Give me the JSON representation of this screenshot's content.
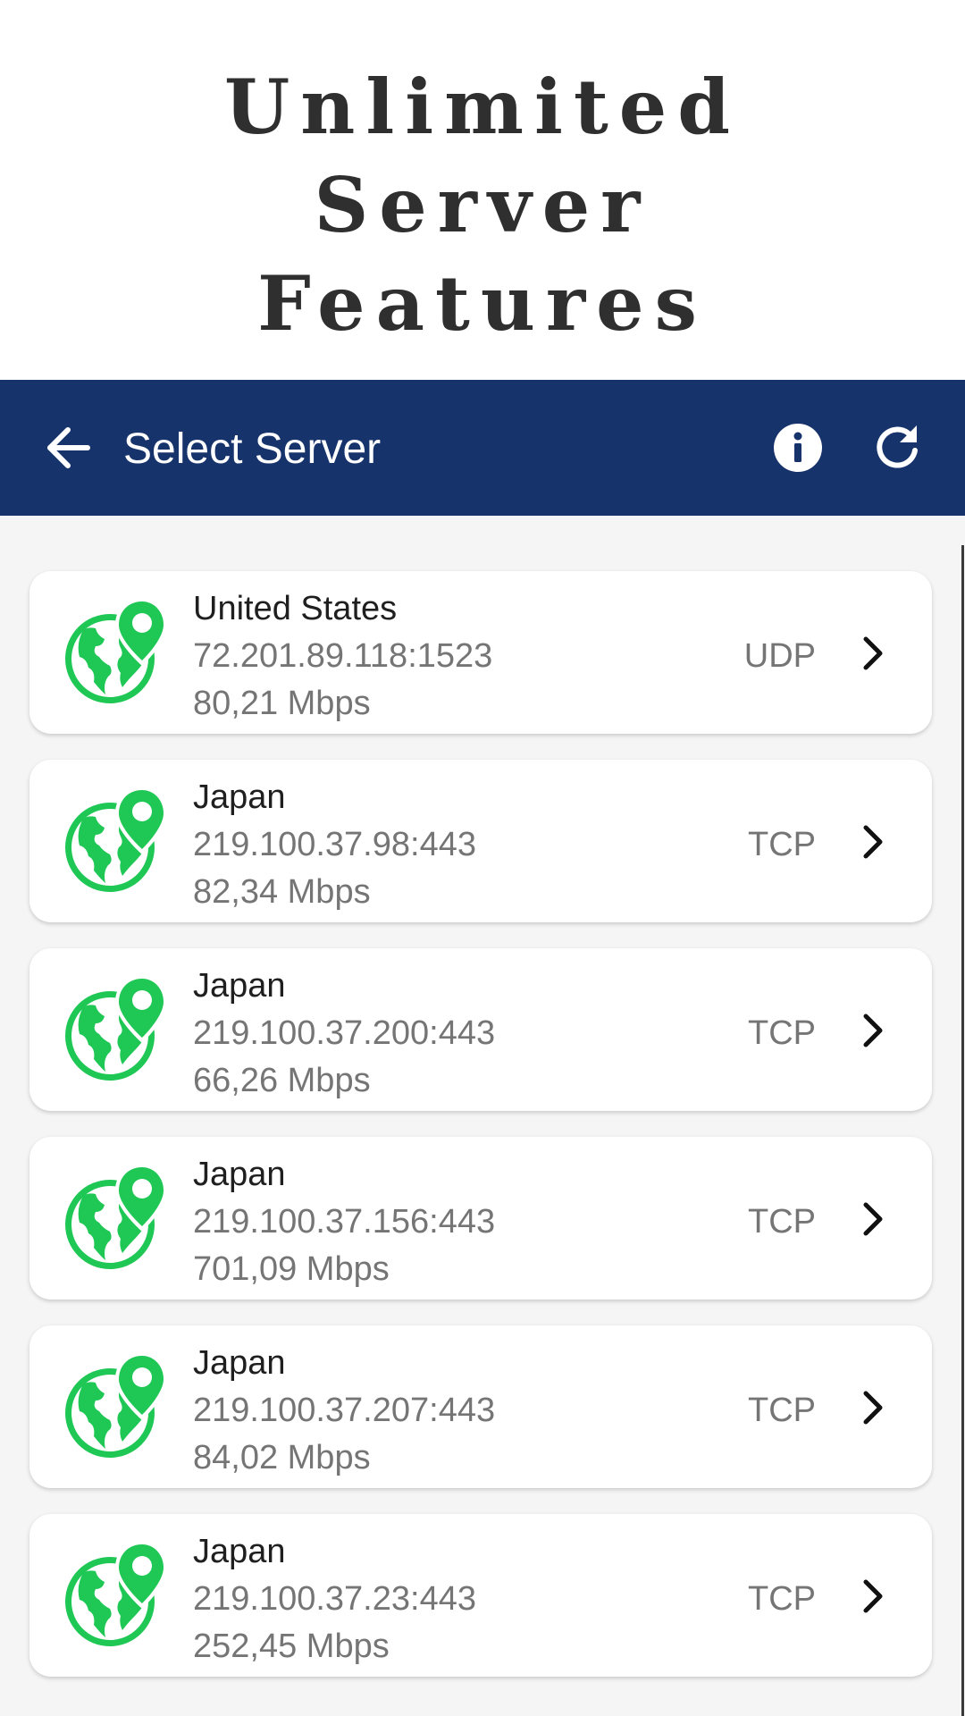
{
  "promo": {
    "line1": "Unlimited",
    "line2": "Server",
    "line3": "Features"
  },
  "appbar": {
    "title": "Select Server",
    "back_icon": "arrow-left-icon",
    "info_icon": "info-icon",
    "refresh_icon": "refresh-icon",
    "background": "#17336b"
  },
  "servers": [
    {
      "country": "United States",
      "address": "72.201.89.118:1523",
      "speed": "80,21 Mbps",
      "protocol": "UDP"
    },
    {
      "country": "Japan",
      "address": "219.100.37.98:443",
      "speed": "82,34 Mbps",
      "protocol": "TCP"
    },
    {
      "country": "Japan",
      "address": "219.100.37.200:443",
      "speed": "66,26 Mbps",
      "protocol": "TCP"
    },
    {
      "country": "Japan",
      "address": "219.100.37.156:443",
      "speed": "701,09 Mbps",
      "protocol": "TCP"
    },
    {
      "country": "Japan",
      "address": "219.100.37.207:443",
      "speed": "84,02 Mbps",
      "protocol": "TCP"
    },
    {
      "country": "Japan",
      "address": "219.100.37.23:443",
      "speed": "252,45 Mbps",
      "protocol": "TCP"
    }
  ],
  "colors": {
    "accent_green": "#1fc755",
    "list_background": "#f5f5f5"
  }
}
